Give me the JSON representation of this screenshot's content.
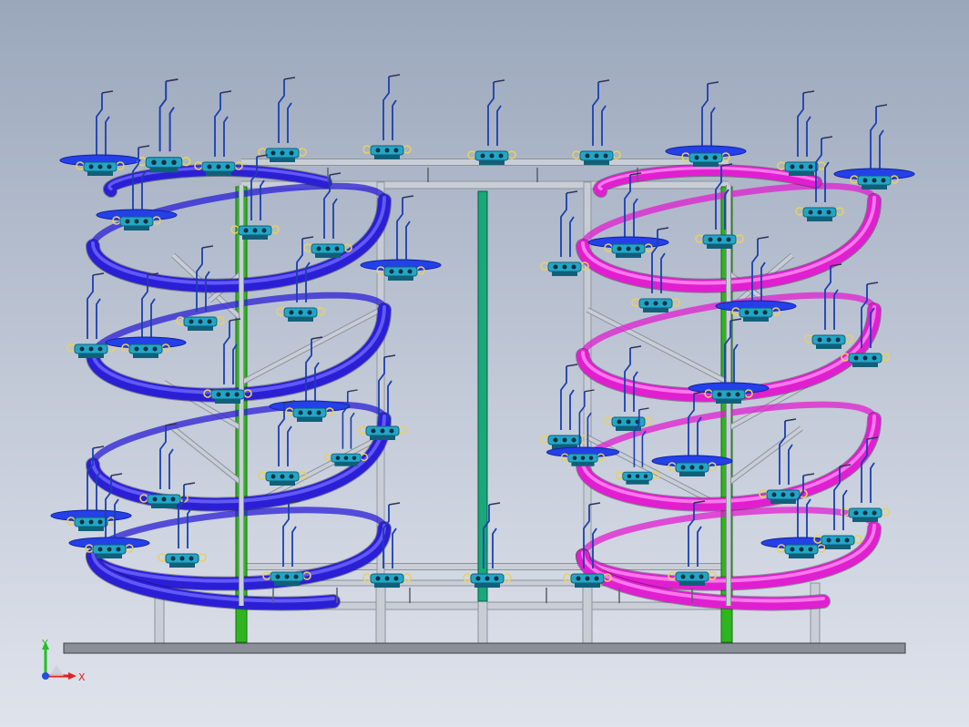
{
  "viewport": {
    "background_top": "#9aa7bb",
    "background_bottom": "#dfe3ec"
  },
  "colors": {
    "left_spiral": "#2b1fd6",
    "left_spiral_highlight": "#6f66ff",
    "right_spiral": "#e01fd0",
    "right_spiral_highlight": "#ff8df2",
    "frame_rail": "#c9ced6",
    "frame_rail_shade": "#8c939e",
    "green_post": "#2fb51f",
    "teal_post": "#18a87a",
    "base_plate": "#8a8f98",
    "carrier_tray": "#2440e8",
    "carrier_tray_dark": "#1020a0",
    "carrier_body": "#22a6c8",
    "carrier_body_dark": "#10607a",
    "hanger": "#1b3fb0",
    "hook": "#e8d060"
  },
  "triad": {
    "y_label": "Y",
    "x_label": "X",
    "y_axis_color": "#22c022",
    "x_axis_color": "#e02020",
    "z_axis_color": "#2050e0"
  }
}
